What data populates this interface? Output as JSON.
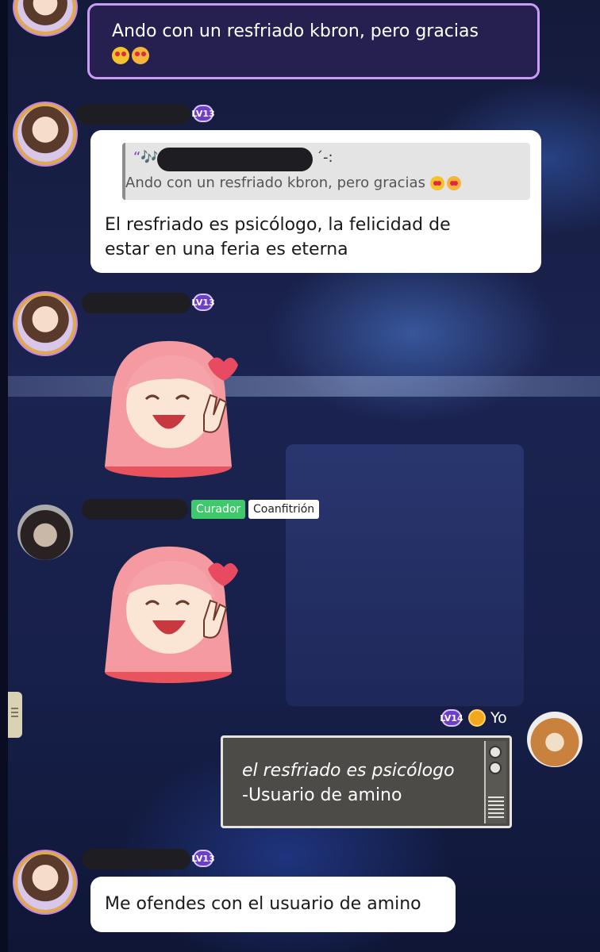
{
  "messages": [
    {
      "text": "Ando con un resfriado kbron, pero gracias"
    },
    {
      "level": "LV13",
      "quote": {
        "prefix": "“🎶",
        "suffix": "´-:",
        "text": "Ando con un resfriado kbron, pero gracias"
      },
      "text_line1": "El resfriado es psicólogo, la felicidad de",
      "text_line2": "estar en una feria es eterna"
    },
    {
      "level": "LV13"
    },
    {
      "badges": {
        "curator": "Curador",
        "cohost": "Coanfitrión"
      }
    },
    {
      "level": "LV14",
      "self_name": "Yo",
      "line1": "el resfriado es psicólogo",
      "line2": "-Usuario de amino"
    },
    {
      "level": "LV13",
      "text": "Me ofendes con el usuario de amino"
    }
  ],
  "colors": {
    "curator_badge": "#3ec96b",
    "level_badge": "#6d3fc7",
    "top_bubble_border": "#c99cf6"
  },
  "icons": [
    "music-note-icon",
    "heart-eyes-emoji-icon",
    "smiling-hearts-emoji-icon",
    "coin-icon",
    "menu-handle-icon"
  ]
}
